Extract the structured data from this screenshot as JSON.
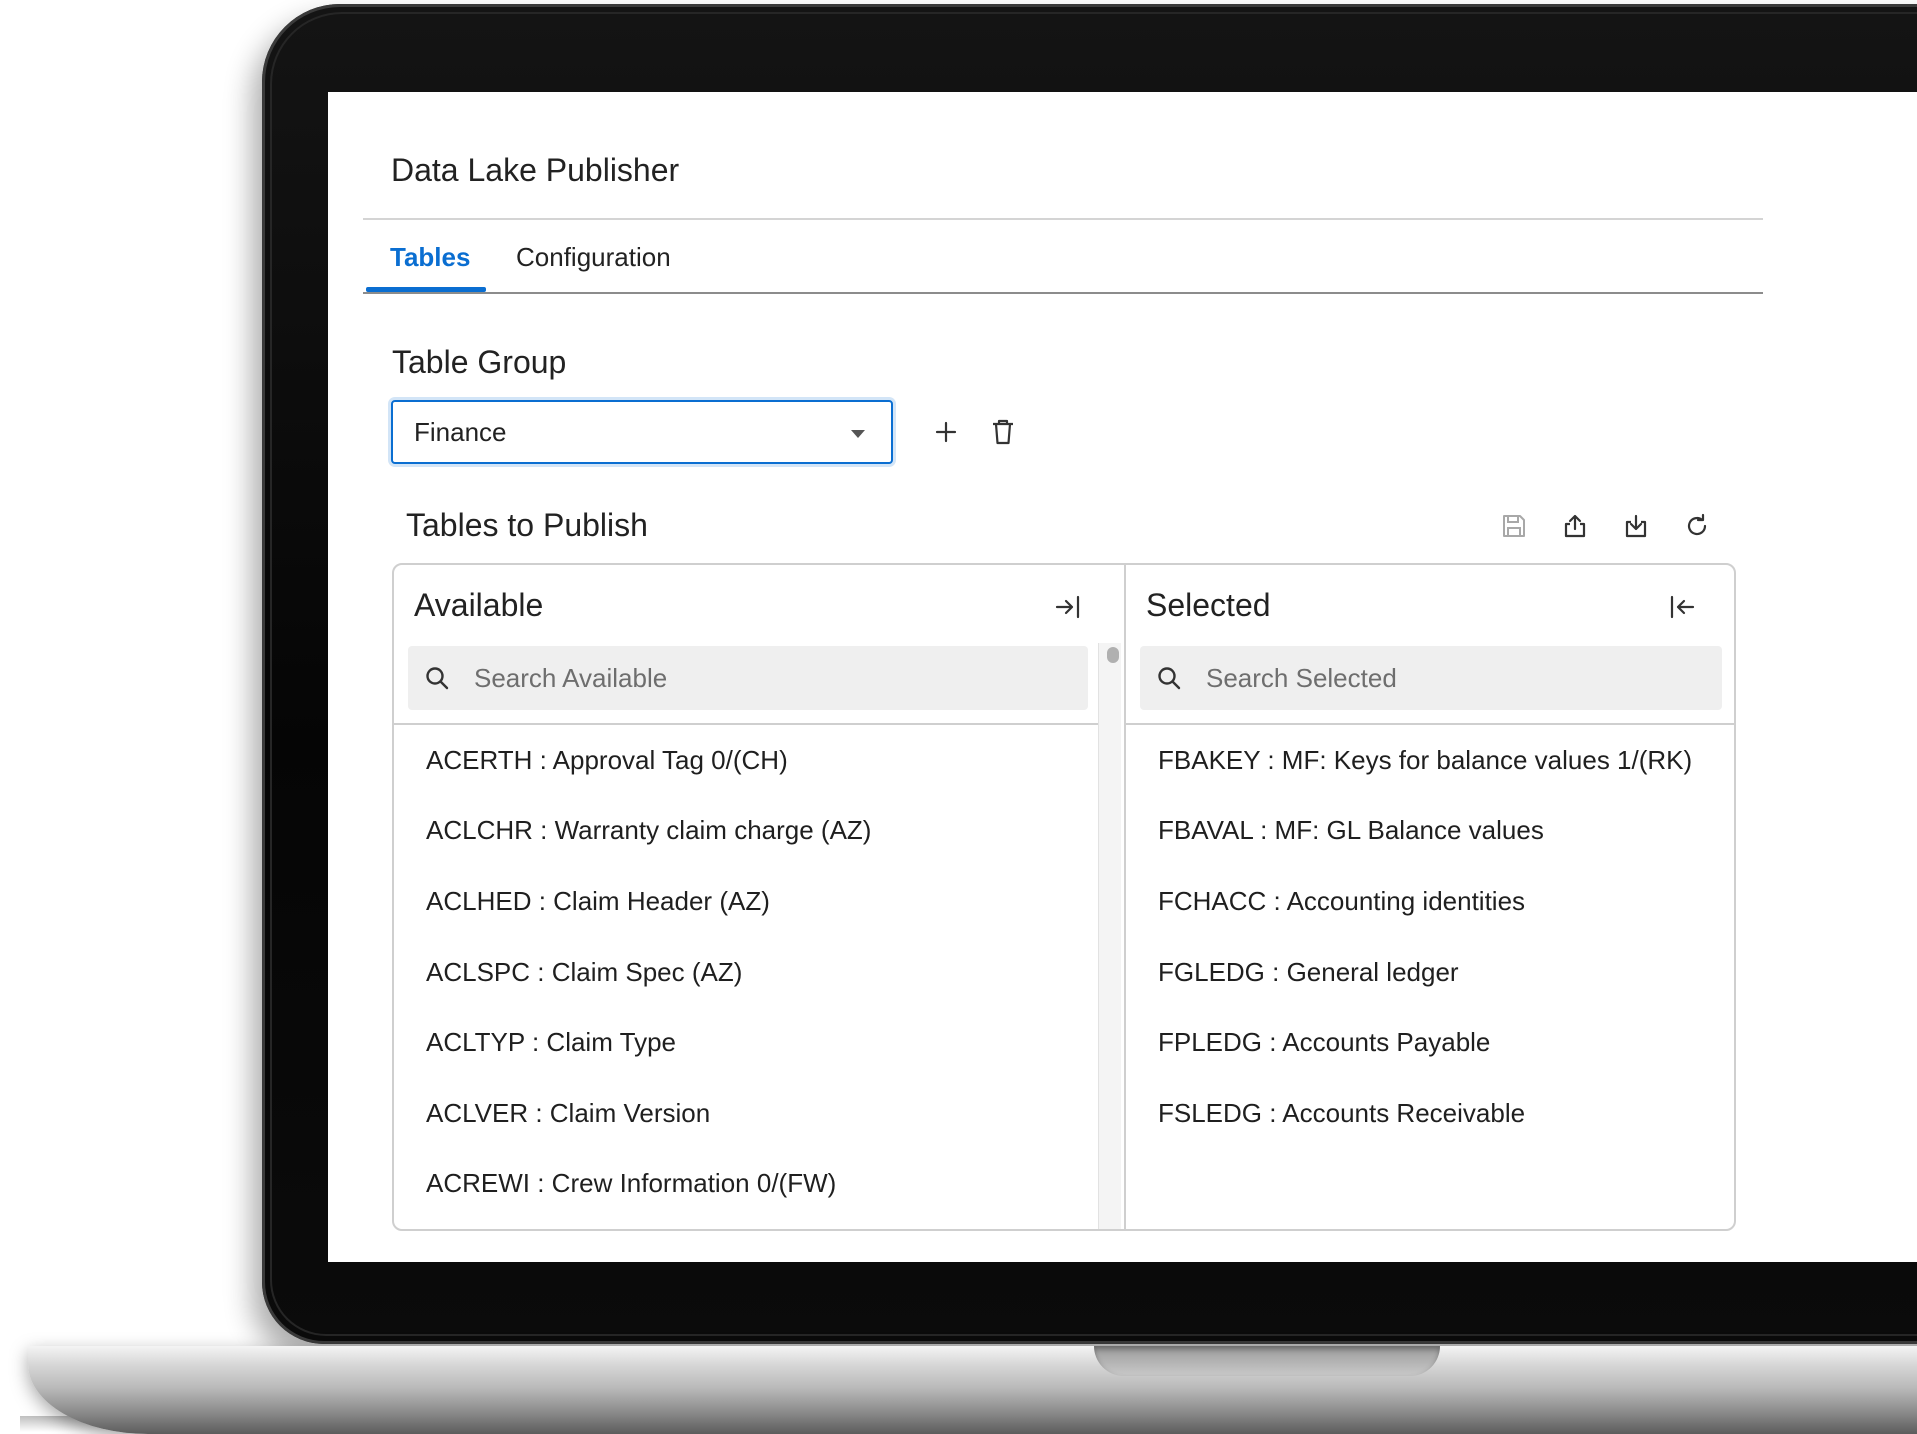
{
  "app": {
    "title": "Data Lake Publisher"
  },
  "tabs": [
    {
      "label": "Tables",
      "active": true
    },
    {
      "label": "Configuration",
      "active": false
    }
  ],
  "table_group": {
    "label": "Table Group",
    "selected": "Finance"
  },
  "publish": {
    "title": "Tables to Publish",
    "toolbar": [
      "save-icon",
      "export-icon",
      "import-icon",
      "refresh-icon"
    ]
  },
  "available": {
    "title": "Available",
    "search_placeholder": "Search Available",
    "items": [
      "ACERTH : Approval Tag 0/(CH)",
      "ACLCHR : Warranty claim charge (AZ)",
      "ACLHED : Claim Header (AZ)",
      "ACLSPC : Claim Spec (AZ)",
      "ACLTYP : Claim Type",
      "ACLVER : Claim Version",
      "ACREWI : Crew Information 0/(FW)"
    ]
  },
  "selected": {
    "title": "Selected",
    "search_placeholder": "Search Selected",
    "items": [
      "FBAKEY : MF: Keys for balance values 1/(RK)",
      "FBAVAL : MF: GL Balance values",
      "FCHACC : Accounting identities",
      "FGLEDG : General ledger",
      "FPLEDG : Accounts Payable",
      "FSLEDG : Accounts Receivable"
    ]
  },
  "colors": {
    "accent": "#0a6ed1",
    "search_bg": "#efefef",
    "border": "#cfcfcf"
  }
}
